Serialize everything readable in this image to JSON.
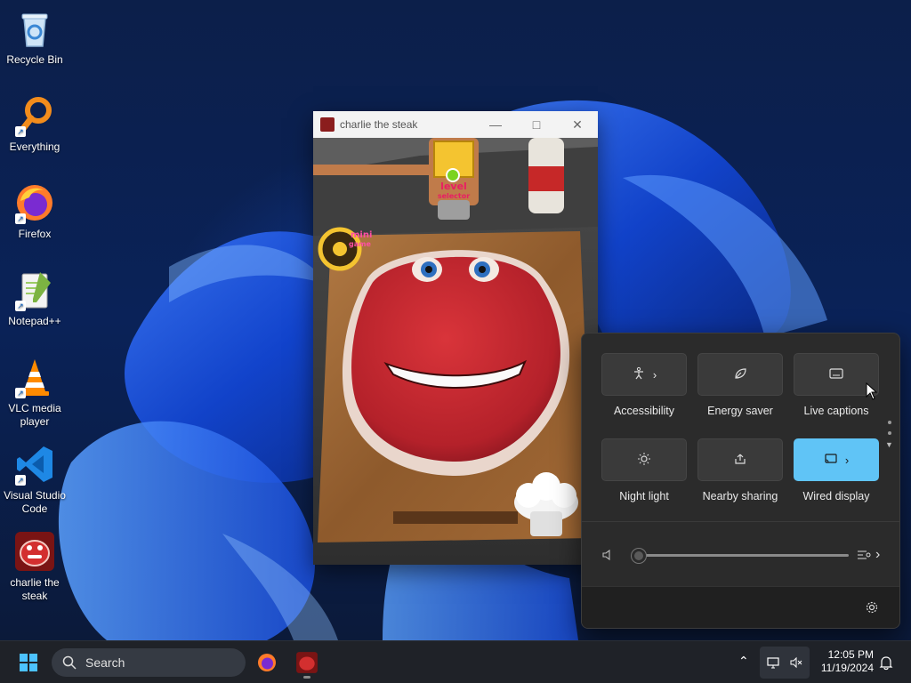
{
  "desktop": {
    "icons": [
      {
        "label": "Recycle Bin",
        "icon": "recycle-bin-icon"
      },
      {
        "label": "Everything",
        "icon": "magnifier-icon"
      },
      {
        "label": "Firefox",
        "icon": "firefox-icon"
      },
      {
        "label": "Notepad++",
        "icon": "notepad-plus-icon"
      },
      {
        "label": "VLC media player",
        "icon": "vlc-cone-icon"
      },
      {
        "label": "Visual Studio Code",
        "icon": "vscode-icon"
      },
      {
        "label": "charlie the steak",
        "icon": "charlie-steak-icon"
      }
    ]
  },
  "window": {
    "title": "charlie the steak",
    "minimize": "—",
    "maximize": "□",
    "close": "✕",
    "game": {
      "badge_top": "level",
      "badge_top2": "selector",
      "badge_left": "mini",
      "badge_left2": "game"
    }
  },
  "quick_settings": {
    "tiles": [
      {
        "label": "Accessibility",
        "icon": "accessibility-icon",
        "chevron": true,
        "active": false
      },
      {
        "label": "Energy saver",
        "icon": "leaf-icon",
        "chevron": false,
        "active": false
      },
      {
        "label": "Live captions",
        "icon": "captions-icon",
        "chevron": false,
        "active": false
      },
      {
        "label": "Night light",
        "icon": "sun-icon",
        "chevron": false,
        "active": false
      },
      {
        "label": "Nearby sharing",
        "icon": "share-icon",
        "chevron": false,
        "active": false
      },
      {
        "label": "Wired display",
        "icon": "cast-icon",
        "chevron": true,
        "active": true
      }
    ],
    "volume": {
      "level": 0,
      "icon": "speaker-muted-icon"
    },
    "accent": "#60c4f6"
  },
  "taskbar": {
    "search_label": "Search",
    "time": "12:05 PM",
    "date": "11/19/2024"
  }
}
